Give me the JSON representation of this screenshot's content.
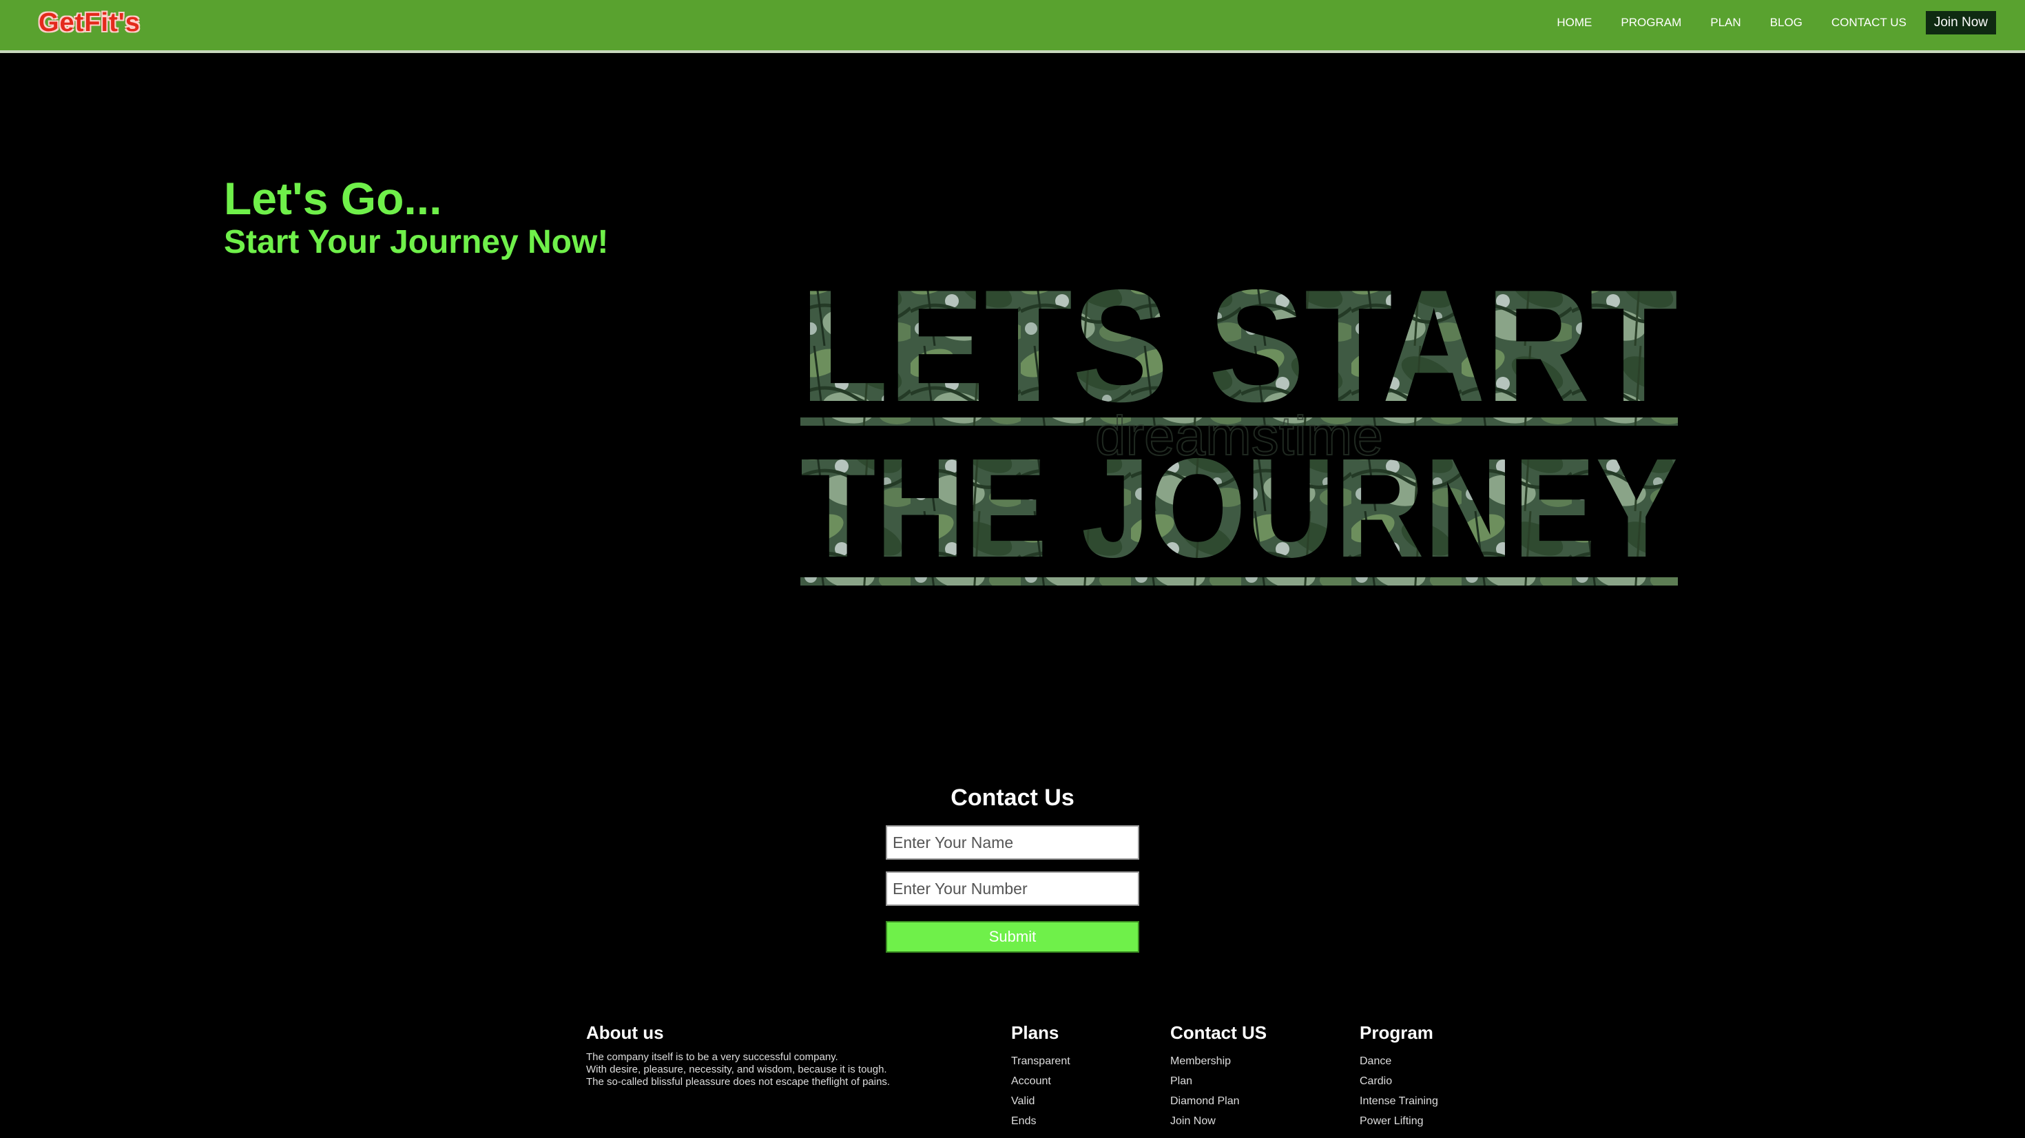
{
  "brand": {
    "logo_text": "GetFit's"
  },
  "nav": {
    "items": [
      "HOME",
      "PROGRAM",
      "PLAN",
      "BLOG",
      "CONTACT US"
    ],
    "join_label": "Join Now"
  },
  "hero": {
    "heading": "Let's Go...",
    "subheading": "Start Your Journey Now!",
    "image": {
      "line1": "LETS START",
      "line2": "THE JOURNEY",
      "watermark": "dreamstime"
    }
  },
  "contact": {
    "title": "Contact Us",
    "name_placeholder": "Enter Your Name",
    "number_placeholder": "Enter Your Number",
    "submit_label": "Submit"
  },
  "footer": {
    "about": {
      "title": "About us",
      "lines": [
        "The company itself is to be a very successful company.",
        "With desire, pleasure, necessity, and wisdom, because it is tough.",
        "The so-called blissful pleassure does not escape theflight of pains."
      ]
    },
    "plans": {
      "title": "Plans",
      "links": [
        "Transparent",
        "Account",
        "Valid",
        "Ends"
      ]
    },
    "contact": {
      "title": "Contact US",
      "links": [
        "Membership",
        "Plan",
        "Diamond Plan",
        "Join Now"
      ]
    },
    "program": {
      "title": "Program",
      "links": [
        "Dance",
        "Cardio",
        "Intense Training",
        "Power Lifting"
      ]
    }
  },
  "colors": {
    "nav_bg": "#59a22f",
    "accent": "#6ff04a",
    "logo": "#e32a1c",
    "join_bg": "#0f2a12",
    "page_bg": "#000000"
  }
}
